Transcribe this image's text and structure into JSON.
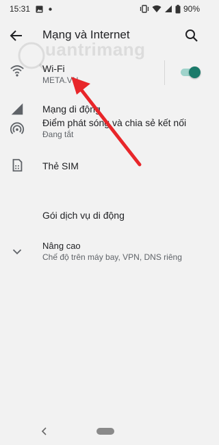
{
  "status_bar": {
    "time": "15:31",
    "battery": "90%"
  },
  "app_bar": {
    "title": "Mạng và Internet",
    "back_icon": "arrow-back-icon",
    "search_icon": "search-icon"
  },
  "watermark": {
    "text": "uantrimang"
  },
  "items": [
    {
      "label": "Wi-Fi",
      "sub": "META.VN",
      "icon": "wifi-icon",
      "toggle_on": true
    },
    {
      "label": "Mạng di động",
      "icon": "cellular-signal-icon"
    },
    {
      "label": "Điểm phát sóng và chia sẻ kết nối",
      "sub": "Đang tắt",
      "icon": "hotspot-icon"
    },
    {
      "label": "Thẻ SIM",
      "icon": "sim-card-icon"
    },
    {
      "label": "Gói dịch vụ di động",
      "icon": ""
    },
    {
      "label": "Nâng cao",
      "sub": "Chế độ trên máy bay, VPN, DNS riêng",
      "icon": "chevron-down-icon"
    }
  ],
  "colors": {
    "background": "#f2f2f2",
    "accent": "#1b7a6a",
    "annotation_arrow": "#e8262a"
  }
}
